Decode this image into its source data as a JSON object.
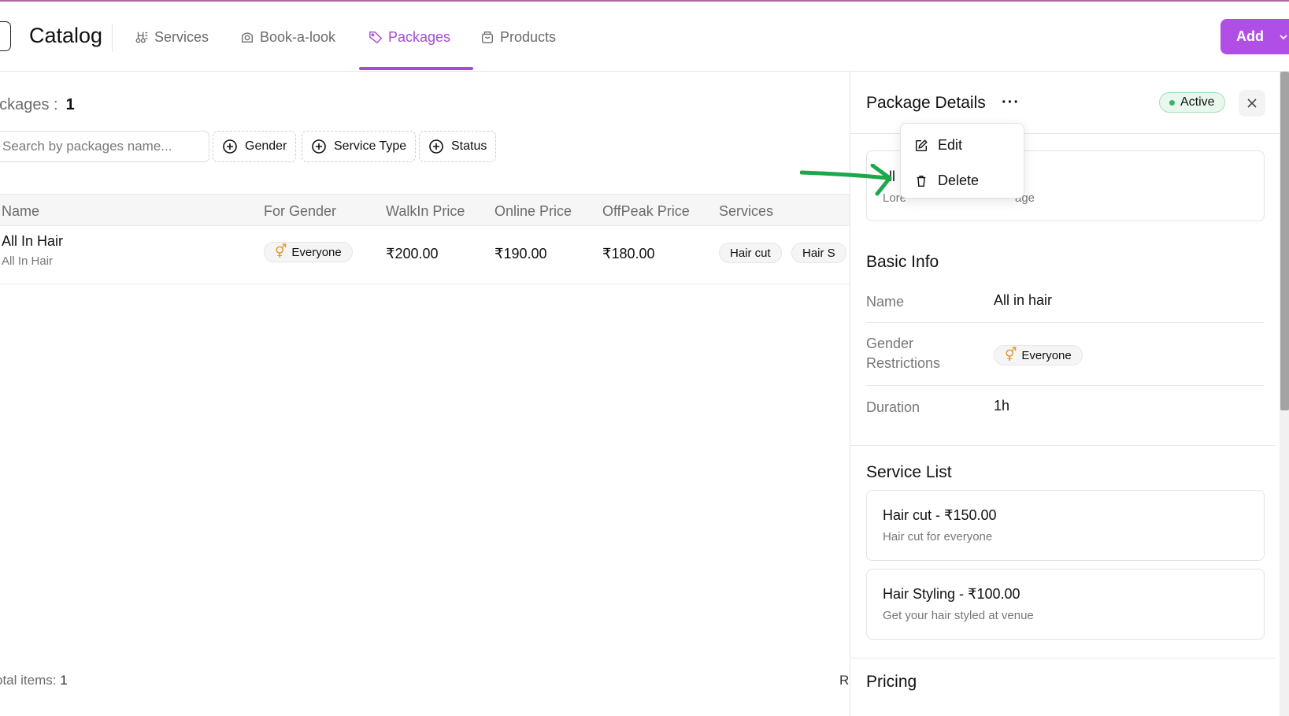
{
  "header": {
    "title": "Catalog",
    "tabs": [
      {
        "label": "Services",
        "icon": "scissors-icon"
      },
      {
        "label": "Book-a-look",
        "icon": "look-icon"
      },
      {
        "label": "Packages",
        "icon": "tag-icon",
        "active": true
      },
      {
        "label": "Products",
        "icon": "bag-icon"
      }
    ],
    "add_label": "Add"
  },
  "main": {
    "count_label": "ackages :",
    "count_value": "1",
    "search_placeholder": "Search by packages name...",
    "filters": [
      "Gender",
      "Service Type",
      "Status"
    ],
    "columns": [
      "Name",
      "For Gender",
      "WalkIn Price",
      "Online Price",
      "OffPeak Price",
      "Services"
    ],
    "rows": [
      {
        "name": "All In Hair",
        "subtitle": "All In Hair",
        "gender": "Everyone",
        "walkin": "₹200.00",
        "online": "₹190.00",
        "offpeak": "₹180.00",
        "services": [
          "Hair cut",
          "Hair S"
        ]
      }
    ],
    "total_label": "otal items:",
    "total_value": "1",
    "cut_text": "R"
  },
  "panel": {
    "title": "Package Details",
    "more": "···",
    "status": "Active",
    "desc_title": "ll",
    "desc_text_left": "Lore",
    "desc_text_right": "age",
    "basic_info_title": "Basic Info",
    "name_label": "Name",
    "name_value": "All in hair",
    "gender_label": "Gender Restrictions",
    "gender_value": "Everyone",
    "duration_label": "Duration",
    "duration_value": "1h",
    "service_list_title": "Service List",
    "services": [
      {
        "title": "Hair cut - ₹150.00",
        "desc": "Hair cut for everyone"
      },
      {
        "title": "Hair Styling - ₹100.00",
        "desc": "Get your hair styled at venue"
      }
    ],
    "pricing_title": "Pricing"
  },
  "menu": {
    "edit": "Edit",
    "delete": "Delete"
  },
  "colors": {
    "accent": "#a54ad8",
    "add_button": "#b14ee6",
    "active_status": "#39b36a",
    "gender_icon": "#e8942a",
    "arrow": "#1aa84a"
  }
}
